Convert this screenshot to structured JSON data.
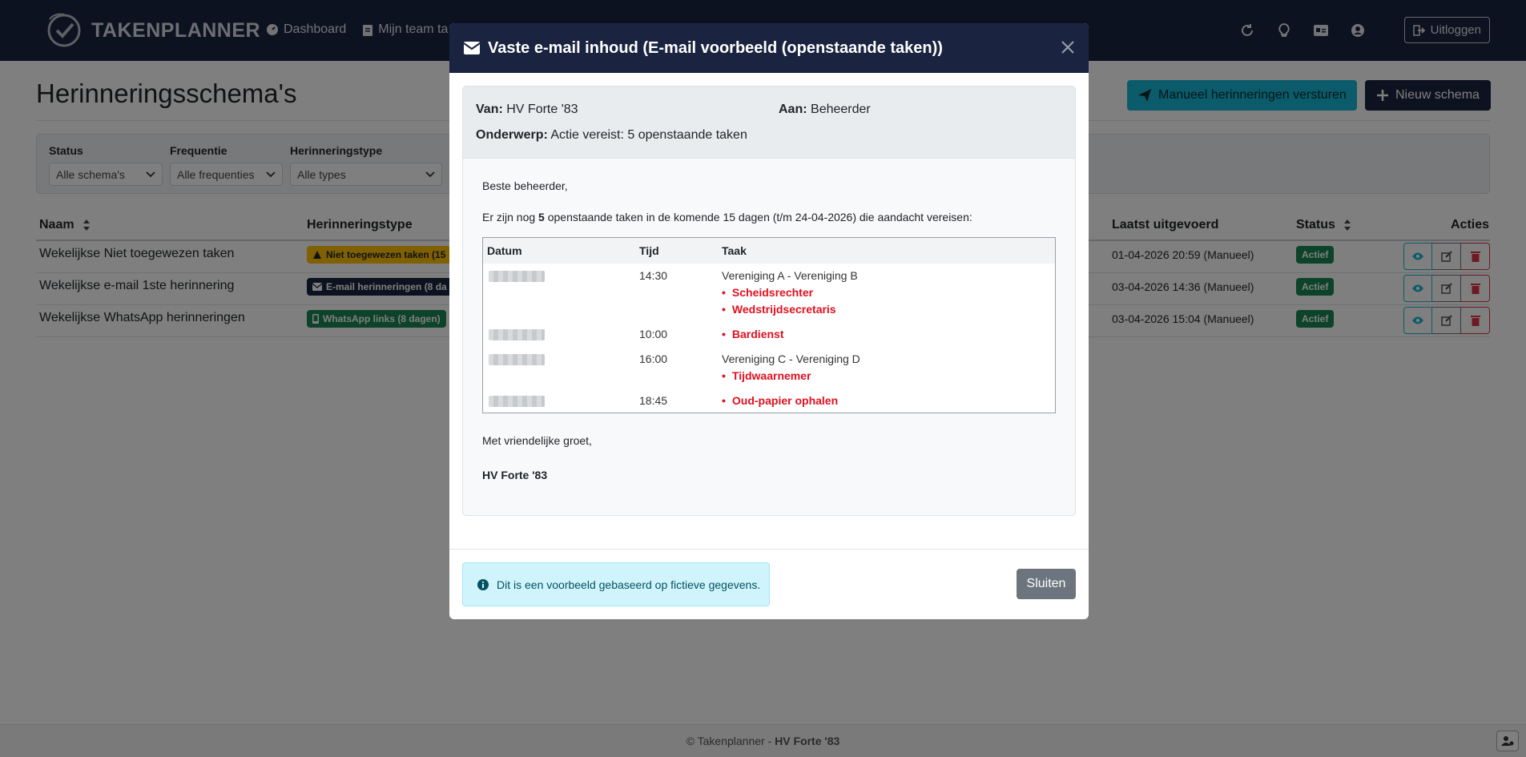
{
  "app": {
    "brand": "TAKENPLANNER",
    "nav": [
      "Dashboard",
      "Mijn team ta"
    ],
    "logout_label": "Uitloggen"
  },
  "page": {
    "title": "Herinneringsschema's",
    "send_button": "Manueel herinneringen versturen",
    "new_button": "Nieuw schema"
  },
  "filters": [
    {
      "label": "Status",
      "value": "Alle schema's"
    },
    {
      "label": "Frequentie",
      "value": "Alle frequenties"
    },
    {
      "label": "Herinneringstype",
      "value": "Alle types"
    }
  ],
  "table": {
    "headers": {
      "name": "Naam",
      "type": "Herinneringstype",
      "last_run": "Laatst uitgevoerd",
      "status": "Status",
      "actions": "Acties"
    },
    "rows": [
      {
        "name": "Wekelijkse Niet toegewezen taken",
        "badge": "Niet toegewezen taken (15",
        "badge_color": "#ffc107",
        "last_run": "01-04-2026 20:59 (Manueel)",
        "status": "Actief"
      },
      {
        "name": "Wekelijkse e-mail 1ste herinnering",
        "badge": "E-mail herinneringen (8 da",
        "badge_color": "#1a2440",
        "last_run": "03-04-2026 14:36 (Manueel)",
        "status": "Actief"
      },
      {
        "name": "Wekelijkse WhatsApp herinneringen",
        "badge": "WhatsApp links (8 dagen)",
        "badge_color": "#198754",
        "last_run": "03-04-2026 15:04 (Manueel)",
        "status": "Actief"
      }
    ]
  },
  "footer": {
    "prefix": "© Takenplanner - ",
    "club": "HV Forte '83"
  },
  "modal": {
    "title": "Vaste e-mail inhoud (E-mail voorbeeld (openstaande taken))",
    "from_label": "Van:",
    "from_value": "HV Forte '83",
    "to_label": "Aan:",
    "to_value": "Beheerder",
    "subject_label": "Onderwerp:",
    "subject_value": "Actie vereist: 5 openstaande taken",
    "greeting": "Beste beheerder,",
    "intro_pre": "Er zijn nog ",
    "intro_count": "5",
    "intro_post": " openstaande taken in de komende 15 dagen (t/m 24-04-2026) die aandacht vereisen:",
    "task_headers": {
      "date": "Datum",
      "time": "Tijd",
      "task": "Taak"
    },
    "tasks": [
      {
        "time": "14:30",
        "match": "Vereniging A - Vereniging B",
        "items": [
          "Scheidsrechter",
          "Wedstrijdsecretaris"
        ]
      },
      {
        "time": "10:00",
        "match": "",
        "items": [
          "Bardienst"
        ]
      },
      {
        "time": "16:00",
        "match": "Vereniging C - Vereniging D",
        "items": [
          "Tijdwaarnemer"
        ]
      },
      {
        "time": "18:45",
        "match": "",
        "items": [
          "Oud-papier ophalen"
        ]
      }
    ],
    "closing": "Met vriendelijke groet,",
    "signature": "HV Forte '83",
    "info": "Dit is een voorbeeld gebaseerd op fictieve gegevens.",
    "close_button": "Sluiten"
  }
}
